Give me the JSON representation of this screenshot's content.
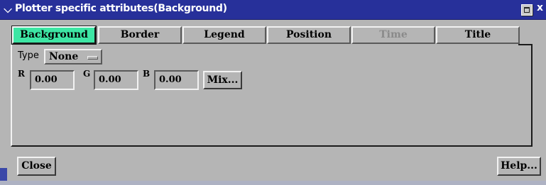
{
  "window": {
    "title": "Plotter specific attributes(Background)",
    "menu_icon": "chevron-down-icon",
    "max_icon": "maximize-icon",
    "close_icon": "close-icon",
    "close_glyph": "x"
  },
  "tabs": [
    {
      "label": "Background",
      "state": "active"
    },
    {
      "label": "Border",
      "state": "normal"
    },
    {
      "label": "Legend",
      "state": "normal"
    },
    {
      "label": "Position",
      "state": "normal"
    },
    {
      "label": "Time",
      "state": "disabled"
    },
    {
      "label": "Title",
      "state": "normal"
    }
  ],
  "background": {
    "type_label": "Type",
    "type_value": "None",
    "r_label": "R",
    "r_value": "0.00",
    "g_label": "G",
    "g_value": "0.00",
    "b_label": "B",
    "b_value": "0.00",
    "mix_label": "Mix..."
  },
  "footer": {
    "close_label": "Close",
    "help_label": "Help..."
  },
  "colors": {
    "titlebar": "#27309a",
    "active_tab": "#3de6a4",
    "face": "#b5b5b5"
  }
}
